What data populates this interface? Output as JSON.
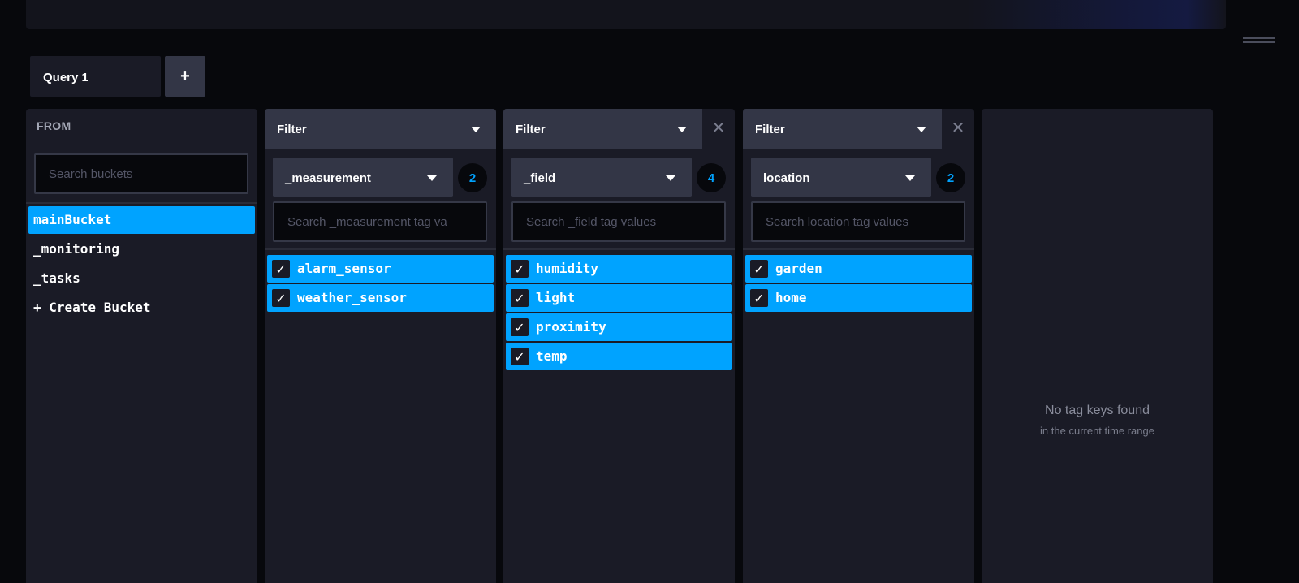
{
  "query_tabs": {
    "active_label": "Query 1",
    "add_label": "+"
  },
  "from": {
    "title": "FROM",
    "search_placeholder": "Search buckets",
    "buckets": [
      {
        "label": "mainBucket",
        "selected": true
      },
      {
        "label": "_monitoring",
        "selected": false
      },
      {
        "label": "_tasks",
        "selected": false
      },
      {
        "label": "+ Create Bucket",
        "selected": false
      }
    ]
  },
  "filters": [
    {
      "header": "Filter",
      "closable": false,
      "key": "_measurement",
      "count": "2",
      "search_placeholder": "Search _measurement tag va",
      "values": [
        {
          "label": "alarm_sensor",
          "checked": true
        },
        {
          "label": "weather_sensor",
          "checked": true
        }
      ]
    },
    {
      "header": "Filter",
      "closable": true,
      "key": "_field",
      "count": "4",
      "search_placeholder": "Search _field tag values",
      "values": [
        {
          "label": "humidity",
          "checked": true
        },
        {
          "label": "light",
          "checked": true
        },
        {
          "label": "proximity",
          "checked": true
        },
        {
          "label": "temp",
          "checked": true
        }
      ]
    },
    {
      "header": "Filter",
      "closable": true,
      "key": "location",
      "count": "2",
      "search_placeholder": "Search location tag values",
      "values": [
        {
          "label": "garden",
          "checked": true
        },
        {
          "label": "home",
          "checked": true
        }
      ]
    }
  ],
  "empty_panel": {
    "title": "No tag keys found",
    "subtitle": "in the current time range"
  },
  "icons": {
    "close": "close-icon",
    "caret": "caret-down-icon",
    "check": "checkmark-icon",
    "resize": "drag-handle-icon"
  },
  "colors": {
    "accent": "#00a3ff",
    "panel": "#1a1b26",
    "header": "#333646",
    "background": "#07080c"
  }
}
